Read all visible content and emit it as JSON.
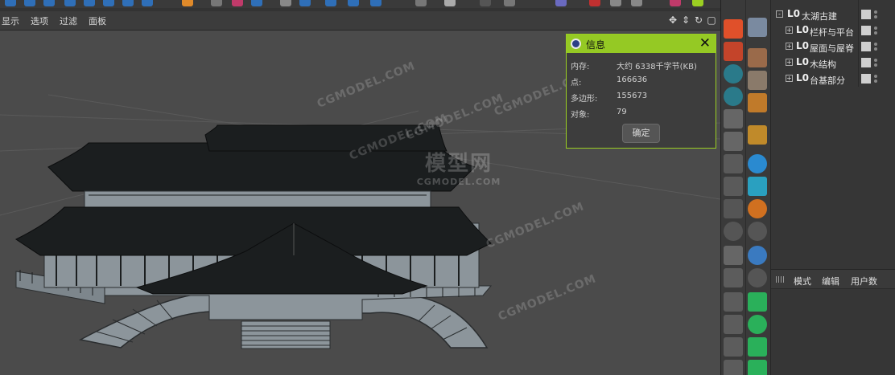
{
  "viewport_menu": {
    "display": "显示",
    "options": "选项",
    "filter": "过滤",
    "panel": "面板"
  },
  "watermark": {
    "repeat_text": "CGMODEL.COM",
    "logo_text": "模型网",
    "logo_sub": "CGMODEL.COM"
  },
  "info_dialog": {
    "title": "信息",
    "close_glyph": "✕",
    "rows": [
      {
        "key": "内存:",
        "value": "大约 6338千字节(KB)"
      },
      {
        "key": "点:",
        "value": "166636"
      },
      {
        "key": "多边形:",
        "value": "155673"
      },
      {
        "key": "对象:",
        "value": "79"
      }
    ],
    "ok_label": "确定"
  },
  "object_manager": {
    "items": [
      {
        "label": "太湖古建",
        "expander": "-"
      },
      {
        "label": "栏杆与平台",
        "expander": "+"
      },
      {
        "label": "屋面与屋脊",
        "expander": "+"
      },
      {
        "label": "木结构",
        "expander": "+"
      },
      {
        "label": "台基部分",
        "expander": "+"
      }
    ],
    "null_icon_text": "L0"
  },
  "attribute_manager": {
    "mode": "模式",
    "edit": "编辑",
    "user_data": "用户数"
  },
  "colors": {
    "accent_green": "#95c924",
    "viewport_bg": "#4b4b4b",
    "model_dark": "#1b1e1f",
    "model_light": "#8c959b"
  }
}
